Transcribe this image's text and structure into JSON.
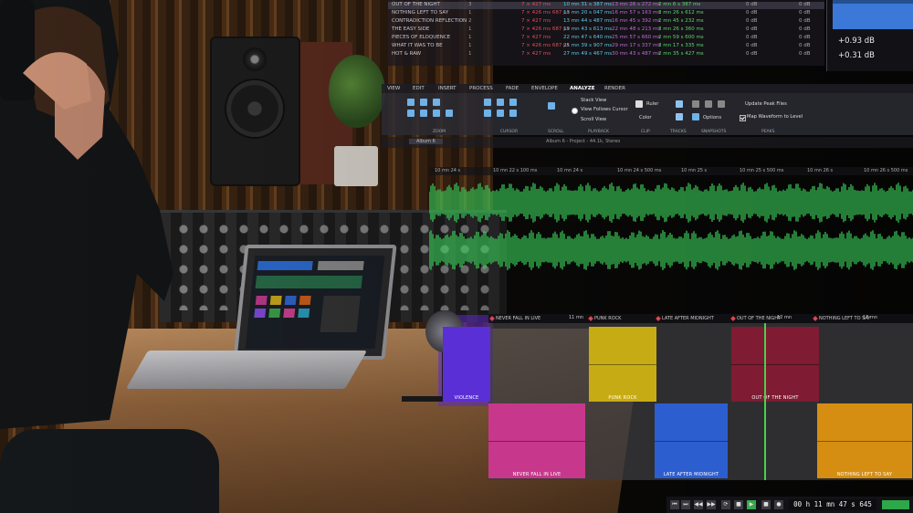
{
  "tracklist": {
    "rows": [
      {
        "name": "OUT OF THE NIGHT",
        "num": "3",
        "pos": "7 × 427 ms",
        "start": "10 mn 31 s 387 ms",
        "end": "13 mn 26 s 272 ms",
        "length": "2 mn 6 s 387 ms",
        "db1": "0 dB",
        "db2": "0 dB"
      },
      {
        "name": "NOTHING LEFT TO SAY",
        "num": "1",
        "pos": "7 × 426 ms 687 µs",
        "start": "13 mn 20 s 047 ms",
        "end": "16 mn 57 s 163 ms",
        "length": "3 mn 26 s 612 ms",
        "db1": "0 dB",
        "db2": "0 dB"
      },
      {
        "name": "CONTRADICTION REFLECTION",
        "num": "2",
        "pos": "7 × 427 ms",
        "start": "13 mn 44 s 487 ms",
        "end": "16 mn 45 s 392 ms",
        "length": "2 mn 45 s 232 ms",
        "db1": "0 dB",
        "db2": "0 dB"
      },
      {
        "name": "THE EASY SIDE",
        "num": "1",
        "pos": "7 × 426 ms 687 µs",
        "start": "19 mn 43 s 613 ms",
        "end": "22 mn 48 s 213 ms",
        "length": "3 mn 26 s 360 ms",
        "db1": "0 dB",
        "db2": "0 dB"
      },
      {
        "name": "PIECES OF ELOQUENCE",
        "num": "1",
        "pos": "7 × 427 ms",
        "start": "22 mn 47 s 640 ms",
        "end": "25 mn 57 s 660 ms",
        "length": "2 mn 59 s 600 ms",
        "db1": "0 dB",
        "db2": "0 dB"
      },
      {
        "name": "WHAT IT WAS TO BE",
        "num": "1",
        "pos": "7 × 426 ms 687 µs",
        "start": "25 mn 39 s 907 ms",
        "end": "29 mn 17 s 337 ms",
        "length": "3 mn 17 s 335 ms",
        "db1": "0 dB",
        "db2": "0 dB"
      },
      {
        "name": "HOT & RAW",
        "num": "1",
        "pos": "7 × 427 ms",
        "start": "27 mn 49 s 467 ms",
        "end": "30 mn 43 s 487 ms",
        "length": "2 mn 35 s 427 ms",
        "db1": "0 dB",
        "db2": "0 dB"
      }
    ]
  },
  "meters": {
    "value1": "+0.93 dB",
    "value2": "+0.31 dB"
  },
  "tabs": [
    "VIEW",
    "EDIT",
    "INSERT",
    "PROCESS",
    "FADE",
    "ENVELOPE",
    "ANALYZE",
    "RENDER"
  ],
  "ribbon": {
    "sections": [
      "ZOOM",
      "CURSOR",
      "SCROLL",
      "PLAYBACK",
      "CLIP",
      "TRACKS",
      "SNAPSHOTS",
      "PEAKS"
    ],
    "stack_view": "Stack View",
    "view_follows_cursor": "View Follows Cursor",
    "scroll_view": "Scroll View",
    "ruler": "Ruler",
    "color": "Color",
    "options": "Options",
    "update_peak_files": "Update Peak Files",
    "map_waveform": "Map Waveform to Level"
  },
  "subbar": {
    "tab_label": "Album 6",
    "center_text": "Album 6 - Project - 44.1k, Stereo"
  },
  "ruler": {
    "ticks": [
      "10 mn 24 s",
      "10 mn 22 s 100 ms",
      "10 mn 24 s",
      "10 mn 24 s 500 ms",
      "10 mn 25 s",
      "10 mn 25 s 500 ms",
      "10 mn 26 s",
      "10 mn 26 s 500 ms"
    ]
  },
  "clip_markers": [
    "NEVER FALL IN LIVE",
    "PUNK ROCK",
    "LATE AFTER MIDNIGHT",
    "OUT OF THE NIGHT",
    "NOTHING LEFT TO SAY"
  ],
  "clip_ticks": [
    "11 mn",
    "12 mn",
    "13 mn"
  ],
  "clips": {
    "violence": "VIOLENCE",
    "punk_rock": "PUNK ROCK",
    "out_of_night": "OUT OF THE NIGHT",
    "never_fall": "NEVER FALL IN LIVE",
    "late_midnight": "LATE AFTER MIDNIGHT",
    "nothing_left": "NOTHING LEFT TO SAY"
  },
  "colors": {
    "violence": "#5b2fd6",
    "punk_rock": "#c7ab14",
    "out_of_night": "#7f1b32",
    "never_fall": "#c7388c",
    "late_midnight": "#2d5ed0",
    "nothing_left": "#d68e12",
    "waveform": "#3bd15a",
    "meter": "#3b78d8"
  },
  "transport": {
    "timecode": "00 h 11 mn 47 s 645 ms",
    "buttons": [
      "skip-start-icon",
      "skip-end-icon",
      "rewind-icon",
      "fast-forward-icon",
      "loop-icon",
      "stop-icon",
      "play-icon",
      "record-icon"
    ]
  }
}
